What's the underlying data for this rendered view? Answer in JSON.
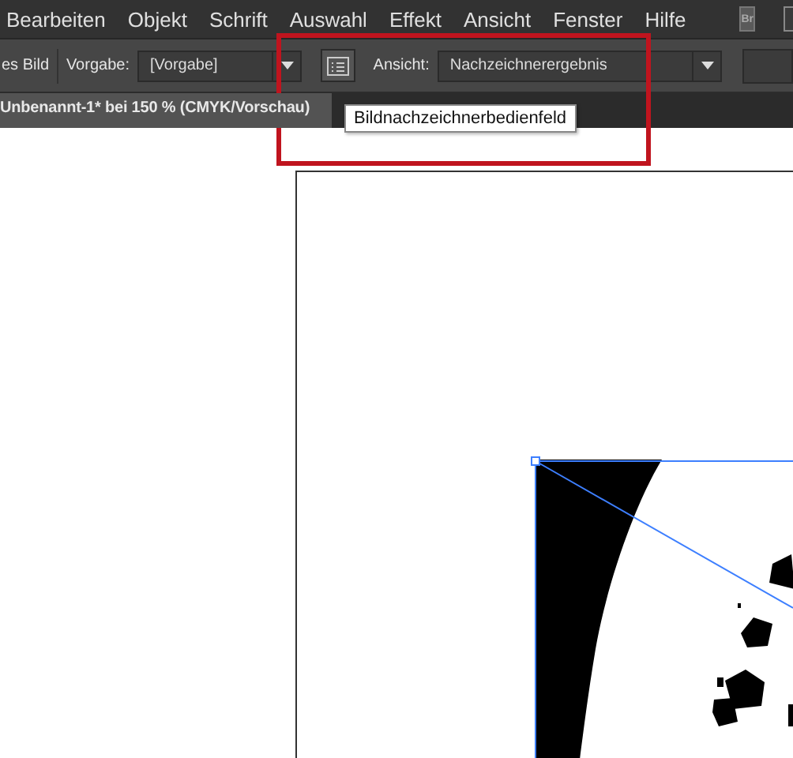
{
  "menu_bar": {
    "items": [
      {
        "label": "Bearbeiten"
      },
      {
        "label": "Objekt"
      },
      {
        "label": "Schrift"
      },
      {
        "label": "Auswahl"
      },
      {
        "label": "Effekt"
      },
      {
        "label": "Ansicht"
      },
      {
        "label": "Fenster"
      },
      {
        "label": "Hilfe"
      }
    ],
    "bridge_button": "Br"
  },
  "control_bar": {
    "leading_text": "es Bild",
    "preset_label": "Vorgabe:",
    "preset_value": "[Vorgabe]",
    "view_label": "Ansicht:",
    "view_value": "Nachzeichnerergebnis"
  },
  "document_tab": {
    "title": "Unbenannt-1* bei 150 % (CMYK/Vorschau)"
  },
  "tooltip": {
    "text": "Bildnachzeichnerbedienfeld"
  },
  "highlight": {
    "color": "#c0141e"
  }
}
